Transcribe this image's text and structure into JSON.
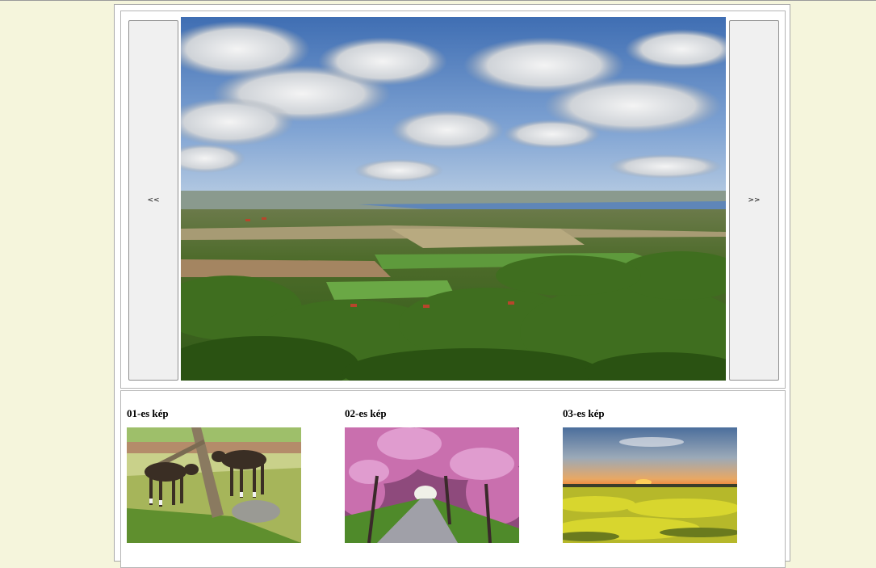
{
  "viewer": {
    "prev_label": "<<",
    "next_label": ">>",
    "main_image": "landscape-panorama-image"
  },
  "gallery": {
    "items": [
      {
        "title": "01-es kép",
        "image": "goats-image"
      },
      {
        "title": "02-es kép",
        "image": "blossom-path-image"
      },
      {
        "title": "03-es kép",
        "image": "sunset-field-image"
      }
    ]
  },
  "colors": {
    "background": "#f5f5dc",
    "page": "#ffffff",
    "button": "#f0f0f0",
    "border": "#a9a9a9"
  }
}
